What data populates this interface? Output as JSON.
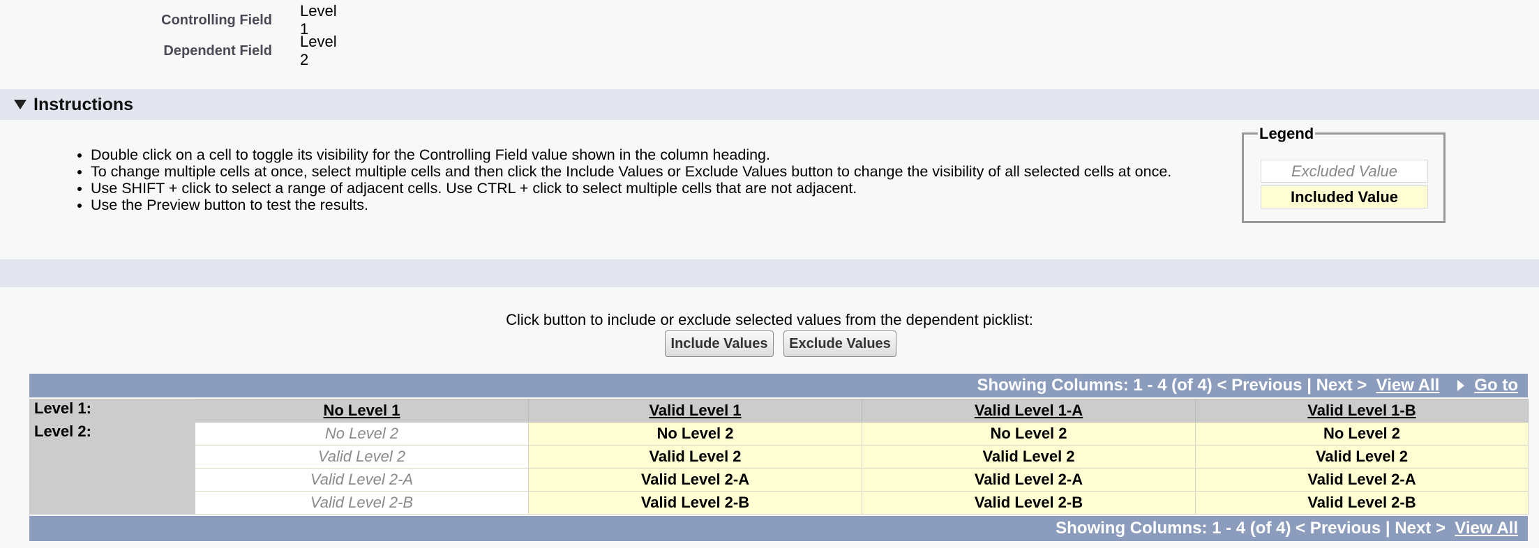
{
  "fields": [
    {
      "label": "Controlling Field",
      "value": "Level 1"
    },
    {
      "label": "Dependent Field",
      "value": "Level 2"
    }
  ],
  "instructions": {
    "title": "Instructions",
    "items": [
      "Double click on a cell to toggle its visibility for the Controlling Field value shown in the column heading.",
      "To change multiple cells at once, select multiple cells and then click the Include Values or Exclude Values button to change the visibility of all selected cells at once.",
      "Use SHIFT + click to select a range of adjacent cells. Use CTRL + click to select multiple cells that are not adjacent.",
      "Use the Preview button to test the results."
    ]
  },
  "legend": {
    "title": "Legend",
    "excluded": "Excluded Value",
    "included": "Included Value"
  },
  "actions": {
    "prompt": "Click button to include or exclude selected values from the dependent picklist:",
    "include": "Include Values",
    "exclude": "Exclude Values"
  },
  "pager": {
    "showing": "Showing Columns: 1 - 4 (of 4)",
    "previous": "< Previous",
    "separator": "|",
    "next": "Next >",
    "view_all": "View All",
    "go_to": "Go to"
  },
  "matrix": {
    "level1_label": "Level 1:",
    "level2_label": "Level 2:",
    "columns": [
      "No Level 1",
      "Valid Level 1",
      "Valid Level 1-A",
      "Valid Level 1-B"
    ],
    "rows": [
      {
        "cells": [
          {
            "text": "No Level 2",
            "state": "excluded"
          },
          {
            "text": "No Level 2",
            "state": "included"
          },
          {
            "text": "No Level 2",
            "state": "included"
          },
          {
            "text": "No Level 2",
            "state": "included"
          }
        ]
      },
      {
        "cells": [
          {
            "text": "Valid Level 2",
            "state": "excluded"
          },
          {
            "text": "Valid Level 2",
            "state": "included"
          },
          {
            "text": "Valid Level 2",
            "state": "included"
          },
          {
            "text": "Valid Level 2",
            "state": "included"
          }
        ]
      },
      {
        "cells": [
          {
            "text": "Valid Level 2-A",
            "state": "excluded"
          },
          {
            "text": "Valid Level 2-A",
            "state": "included"
          },
          {
            "text": "Valid Level 2-A",
            "state": "included"
          },
          {
            "text": "Valid Level 2-A",
            "state": "included"
          }
        ]
      },
      {
        "cells": [
          {
            "text": "Valid Level 2-B",
            "state": "excluded"
          },
          {
            "text": "Valid Level 2-B",
            "state": "included"
          },
          {
            "text": "Valid Level 2-B",
            "state": "included"
          },
          {
            "text": "Valid Level 2-B",
            "state": "included"
          }
        ]
      }
    ]
  },
  "colors": {
    "section_bar": "#e3e6ef",
    "pager_bar": "#8c9cbd",
    "included_bg": "#fefed2",
    "excluded_bg": "#ffffff",
    "header_bg": "#cccccc"
  }
}
